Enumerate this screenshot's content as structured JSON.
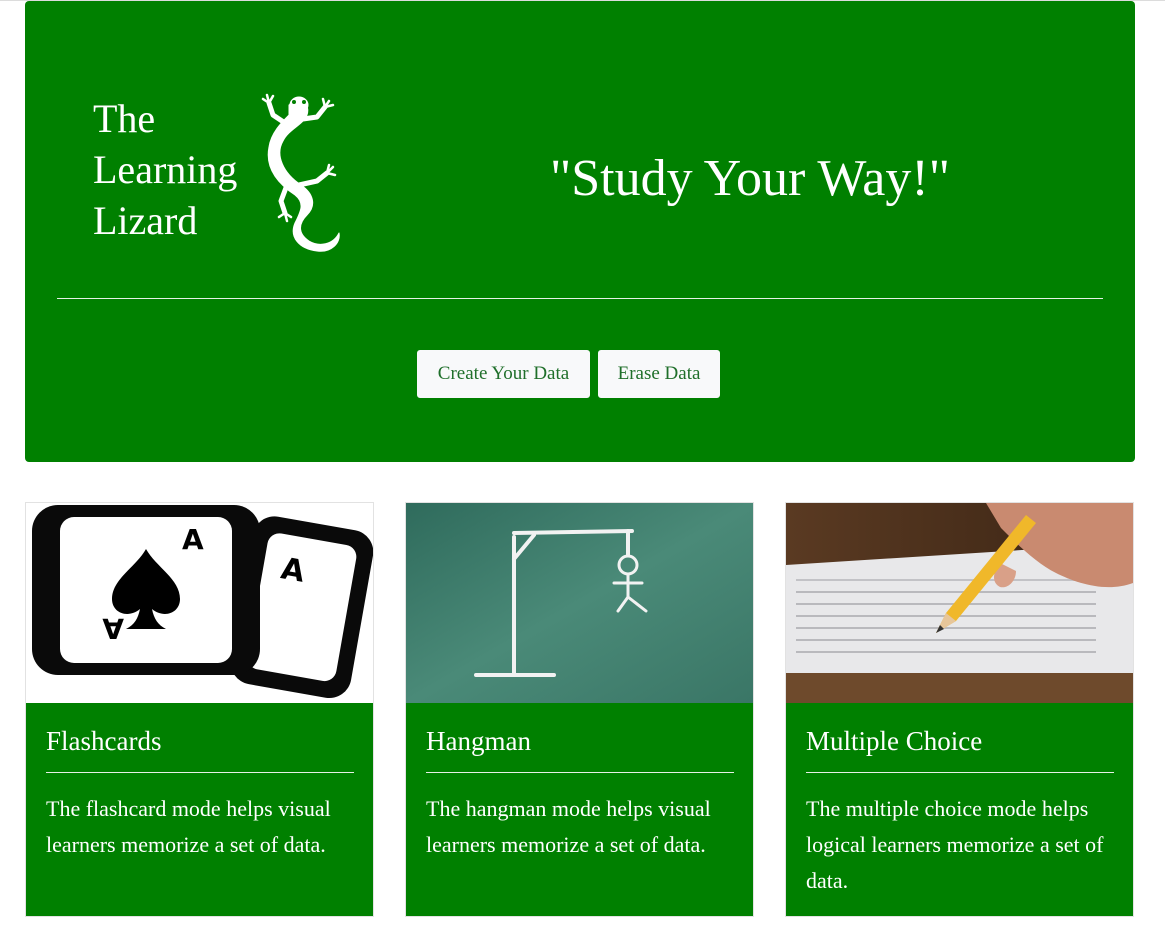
{
  "header": {
    "brand_line1": "The",
    "brand_line2": "Learning",
    "brand_line3": "Lizard",
    "logo_icon": "lizard-icon",
    "tagline": "\"Study Your Way!\"",
    "create_button": "Create Your Data",
    "erase_button": "Erase Data"
  },
  "cards": [
    {
      "title": "Flashcards",
      "text": "The flashcard mode helps visual learners memorize a set of data.",
      "image": "playing-cards-ace-of-spades"
    },
    {
      "title": "Hangman",
      "text": "The hangman mode helps visual learners memorize a set of data.",
      "image": "hangman-chalkboard"
    },
    {
      "title": "Multiple Choice",
      "text": "The multiple choice mode helps logical learners memorize a set of data.",
      "image": "pencil-answer-sheet"
    }
  ],
  "colors": {
    "primary_green": "#008000",
    "button_bg": "#f8f9fa",
    "button_text": "#1f6f2a",
    "chalkboard": "#3e7f6a"
  }
}
